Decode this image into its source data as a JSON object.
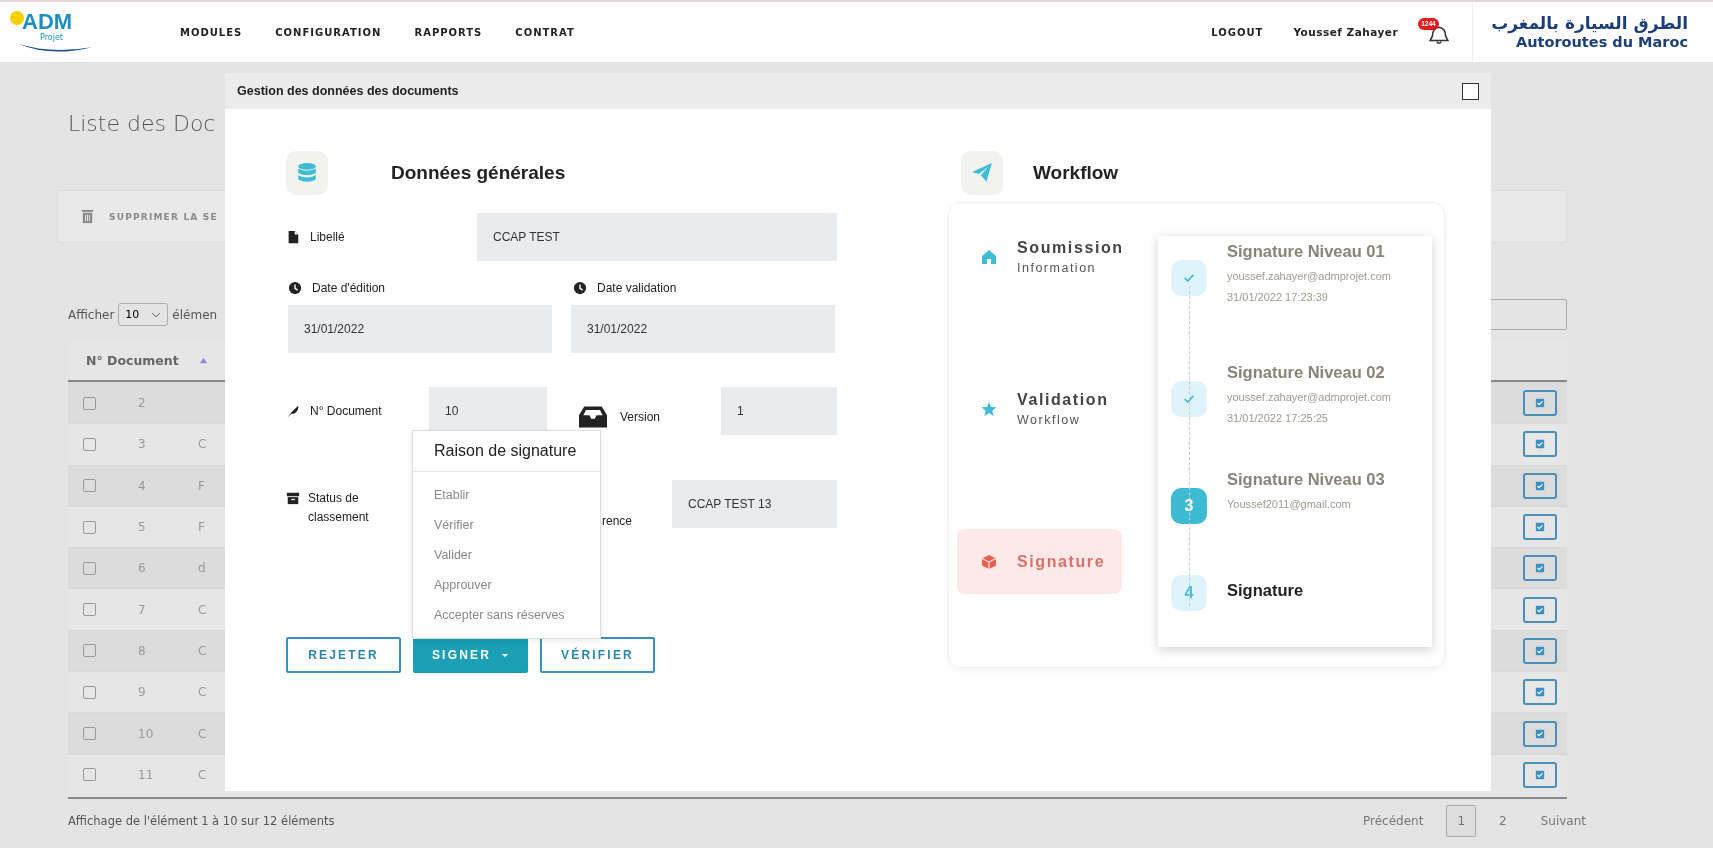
{
  "header": {
    "logo": {
      "title": "ADM",
      "subtitle": "Projet"
    },
    "nav": [
      "MODULES",
      "CONFIGURATION",
      "RAPPORTS",
      "CONTRAT"
    ],
    "logout": "LOGOUT",
    "user": "Youssef Zahayer",
    "notifications": "1244",
    "brand": {
      "arabic": "الطرق السيارة بالمغرب",
      "latin": "Autoroutes du Maroc"
    }
  },
  "page": {
    "heading": "Liste des Doc",
    "delete_button": "SUPPRIMER LA SE",
    "length": {
      "prefix": "Afficher",
      "value": "10",
      "suffix": "élémen"
    },
    "table": {
      "columns": [
        "N° Document"
      ],
      "rows": [
        {
          "checked": false,
          "number": "2"
        },
        {
          "checked": false,
          "number": "3",
          "column_3": "C"
        },
        {
          "checked": false,
          "number": "4",
          "column_3": "F"
        },
        {
          "checked": false,
          "number": "5",
          "column_3": "F"
        },
        {
          "checked": false,
          "number": "6",
          "column_3": "d"
        },
        {
          "checked": false,
          "number": "7",
          "column_3": "C"
        },
        {
          "checked": false,
          "number": "8",
          "column_3": "C"
        },
        {
          "checked": false,
          "number": "9",
          "column_3": "C"
        },
        {
          "checked": false,
          "number": "10",
          "column_3": "C"
        },
        {
          "checked": false,
          "number": "11",
          "column_3": "C"
        }
      ]
    },
    "info": "Affichage de l'élément 1 à 10 sur 12 éléments",
    "pagination": [
      {
        "label": "Précédent",
        "selected": false
      },
      {
        "label": "1",
        "selected": true
      },
      {
        "label": "2",
        "selected": false
      },
      {
        "label": "Suivant",
        "selected": false
      }
    ]
  },
  "modal": {
    "title": "Gestion des données des documents",
    "general": {
      "title": "Données générales",
      "libelle": {
        "label": "Libellé",
        "value": "CCAP TEST"
      },
      "date_edition": {
        "label": "Date d'édition",
        "value": "31/01/2022"
      },
      "date_validation": {
        "label": "Date validation",
        "value": "31/01/2022"
      },
      "numero": {
        "label": "N° Document",
        "value": "10"
      },
      "version": {
        "label": "Version",
        "value": "1"
      },
      "status_label": "Status de classement",
      "reference": {
        "label": "rence",
        "value": "CCAP TEST 13"
      },
      "buttons": [
        {
          "label": "REJETER",
          "kind": "outline"
        },
        {
          "label": "SIGNER",
          "kind": "dropdown"
        },
        {
          "label": "VÉRIFIER",
          "kind": "outline"
        }
      ],
      "dropdown": {
        "title": "Raison de signature",
        "items": [
          "Etablir",
          "Vérifier",
          "Valider",
          "Approuver",
          "Accepter sans réserves"
        ]
      }
    },
    "workflow": {
      "title": "Workflow",
      "phases": [
        {
          "title": "Soumission",
          "subtitle": "Information",
          "selected": false
        },
        {
          "title": "Validation",
          "subtitle": "Workflow",
          "selected": false
        },
        {
          "title": "Signature",
          "selected": true
        }
      ],
      "steps": [
        {
          "kind": "done",
          "title": "Signature Niveau 01",
          "email": "youssef.zahayer@admprojet.com",
          "time": "31/01/2022 17:23:39"
        },
        {
          "kind": "done",
          "title": "Signature Niveau 02",
          "email": "youssef.zahayer@admprojet.com",
          "time": "31/01/2022 17:25:25"
        },
        {
          "kind": "current",
          "number": "3",
          "title": "Signature Niveau 03",
          "email": "Youssef2011@gmail.com"
        },
        {
          "kind": "pending",
          "number": "4",
          "title": "Signature"
        }
      ]
    }
  }
}
